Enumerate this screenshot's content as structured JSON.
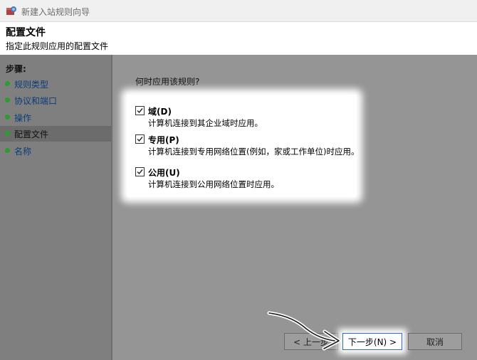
{
  "window": {
    "title": "新建入站规则向导"
  },
  "header": {
    "title": "配置文件",
    "subtitle": "指定此规则应用的配置文件"
  },
  "steps": {
    "title": "步骤:",
    "items": [
      {
        "label": "规则类型",
        "active": false
      },
      {
        "label": "协议和端口",
        "active": false
      },
      {
        "label": "操作",
        "active": false
      },
      {
        "label": "配置文件",
        "active": true
      },
      {
        "label": "名称",
        "active": false
      }
    ]
  },
  "main": {
    "question": "何时应用该规则?",
    "options": [
      {
        "name": "域(D)",
        "description": "计算机连接到其企业域时应用。",
        "checked": true
      },
      {
        "name": "专用(P)",
        "description": "计算机连接到专用网络位置(例如，家或工作单位)时应用。",
        "checked": true
      },
      {
        "name": "公用(U)",
        "description": "计算机连接到公用网络位置时应用。",
        "checked": true
      }
    ]
  },
  "buttons": {
    "back": "< 上一步",
    "next": "下一步(N) >",
    "cancel": "取消"
  },
  "colors": {
    "step_dot": "#2e9b2e",
    "next_border": "#2b6ad8"
  }
}
